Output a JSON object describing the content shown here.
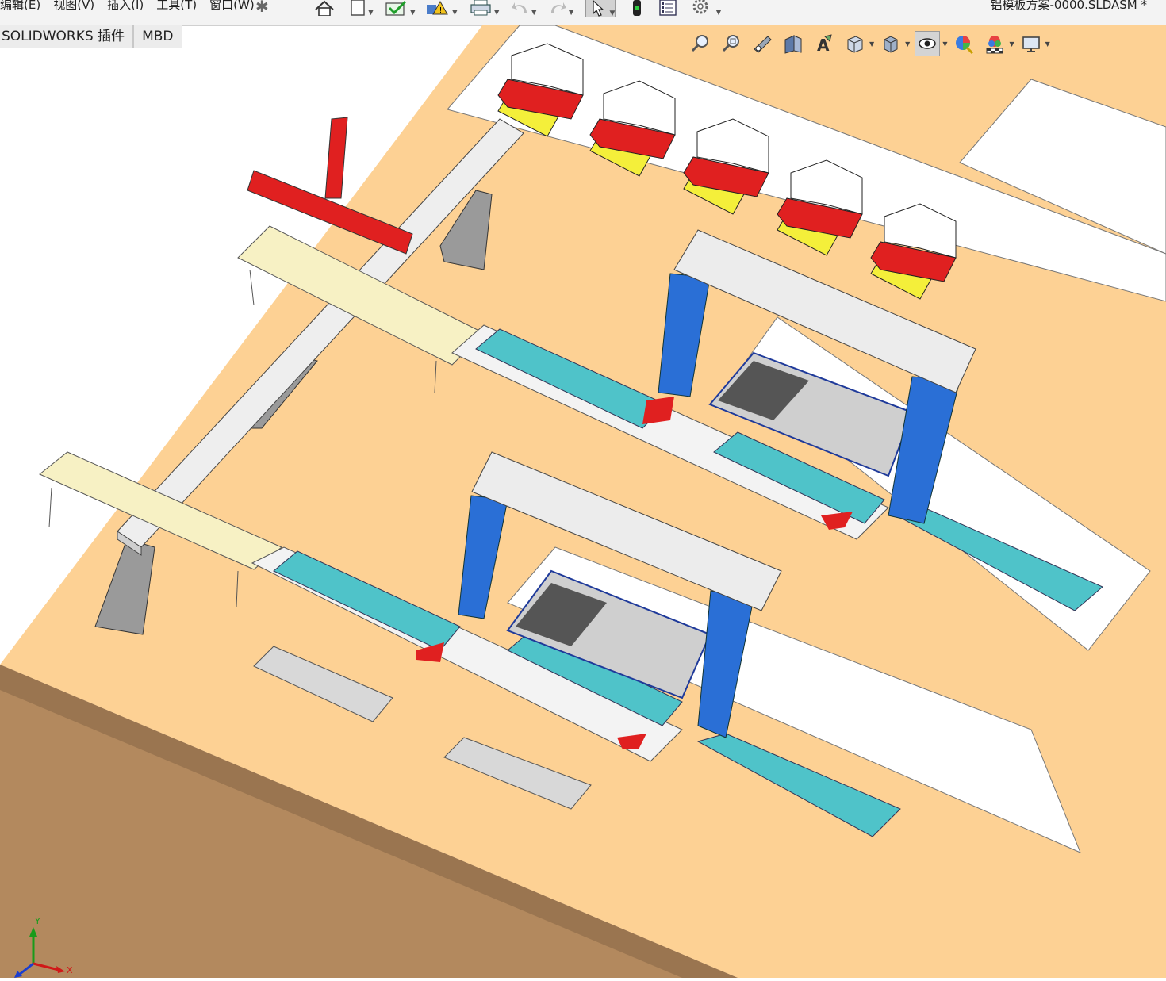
{
  "menu": {
    "items": [
      "编辑(E)",
      "视图(V)",
      "插入(I)",
      "工具(T)",
      "窗口(W)"
    ]
  },
  "window": {
    "title": "铝模板方案-0000.SLDASM *"
  },
  "tabs": [
    {
      "label": "SOLIDWORKS 插件"
    },
    {
      "label": "MBD"
    }
  ],
  "toolbar": {
    "icons": [
      "home-icon",
      "new-document-icon",
      "rebuild-check-icon",
      "warning-icon",
      "print-icon",
      "undo-icon",
      "redo-icon",
      "select-pointer-icon",
      "traffic-light-icon",
      "file-properties-icon",
      "options-gear-icon"
    ]
  },
  "heads_up": {
    "icons": [
      "zoom-to-fit-icon",
      "zoom-to-area-icon",
      "previous-view-icon",
      "section-view-icon",
      "dynamic-annotation-icon",
      "view-orientation-icon",
      "display-style-icon",
      "hide-show-items-icon",
      "edit-appearance-icon",
      "apply-scene-icon",
      "view-settings-icon"
    ]
  },
  "triad": {
    "x_label": "X",
    "y_label": "Y"
  },
  "colors": {
    "floor": "#fdd194",
    "floor_edge": "#b3895e",
    "gantry_blue": "#2a6fd6",
    "robot_red": "#e02020",
    "agv_yellow": "#f4ef3a",
    "conveyor_teal": "#4fc3c9"
  }
}
